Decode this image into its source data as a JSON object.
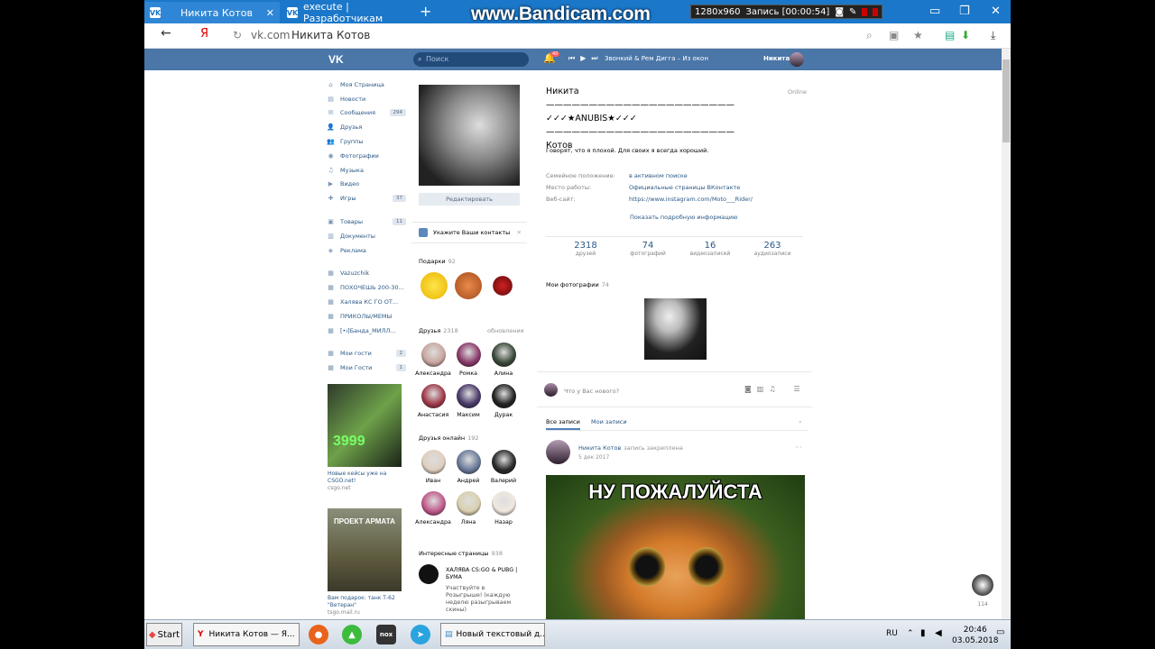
{
  "browser": {
    "tabs": [
      {
        "title": "Никита Котов",
        "icon": "vk-icon"
      },
      {
        "title": "execute | Разработчикам",
        "icon": "vk-icon"
      }
    ],
    "new_tab": "+",
    "address_host": "vk.com",
    "address_title": "Никита Котов",
    "back": "←",
    "yandex": "Я"
  },
  "recorder": {
    "watermark": "www.Bandicam.com",
    "resolution": "1280x960",
    "recording": "Запись [00:00:54]"
  },
  "vk": {
    "search_placeholder": "Поиск",
    "notif_count": "40",
    "track": "Звонкий & Рем Дигга – Из окон",
    "user": "Никита",
    "accent": "#4a76a8"
  },
  "nav": {
    "items": [
      {
        "label": "Моя Страница",
        "icon": "home-icon",
        "glyph": "⌂",
        "count": ""
      },
      {
        "label": "Новости",
        "icon": "news-icon",
        "glyph": "▤",
        "count": ""
      },
      {
        "label": "Сообщения",
        "icon": "message-icon",
        "glyph": "✉",
        "count": "294"
      },
      {
        "label": "Друзья",
        "icon": "friends-icon",
        "glyph": "👤",
        "count": ""
      },
      {
        "label": "Группы",
        "icon": "groups-icon",
        "glyph": "👥",
        "count": ""
      },
      {
        "label": "Фотографии",
        "icon": "camera-icon",
        "glyph": "◉",
        "count": ""
      },
      {
        "label": "Музыка",
        "icon": "music-icon",
        "glyph": "♫",
        "count": ""
      },
      {
        "label": "Видео",
        "icon": "video-icon",
        "glyph": "▶",
        "count": ""
      },
      {
        "label": "Игры",
        "icon": "games-icon",
        "glyph": "✚",
        "count": "37"
      }
    ],
    "items2": [
      {
        "label": "Товары",
        "icon": "shop-icon",
        "glyph": "▣",
        "count": "11"
      },
      {
        "label": "Документы",
        "icon": "docs-icon",
        "glyph": "▥",
        "count": ""
      },
      {
        "label": "Реклама",
        "icon": "ads-icon",
        "glyph": "◈",
        "count": ""
      }
    ],
    "items3": [
      {
        "label": "Vazuzchik",
        "icon": "app-icon",
        "glyph": "▦",
        "count": ""
      },
      {
        "label": "ПОХОЧЕШЬ 200-30...",
        "icon": "app-icon",
        "glyph": "▦",
        "count": ""
      },
      {
        "label": "Халява КС ГО ОТ...",
        "icon": "app-icon",
        "glyph": "▦",
        "count": ""
      },
      {
        "label": "ПРИКОЛЫ/МЕМЫ",
        "icon": "app-icon",
        "glyph": "▦",
        "count": ""
      },
      {
        "label": "[•ı]Банда_МИЛЛ...",
        "icon": "app-icon",
        "glyph": "▦",
        "count": ""
      }
    ],
    "items4": [
      {
        "label": "Мои гости",
        "icon": "guests-icon",
        "glyph": "▦",
        "count": "2"
      },
      {
        "label": "Мои Гости",
        "icon": "guests-icon",
        "glyph": "▦",
        "count": "1"
      }
    ]
  },
  "ads": [
    {
      "title": "Новые кейсы уже на CSGO.net!",
      "source": "csgo.net",
      "badge": "3999"
    },
    {
      "title": "Вам подарок: танк Т-62 \"Ветеран\"",
      "source": "tsgo.mail.ru",
      "badge": "ПРОЕКТ АРМАТА"
    }
  ],
  "profile": {
    "edit": "Редактировать",
    "contacts": "Укажите Ваши контакты",
    "gifts_label": "Подарки",
    "gifts_count": "92",
    "friends_label": "Друзья",
    "friends_count": "2318",
    "friends_updates": "обновления",
    "friends": [
      "Александра",
      "Ромка",
      "Алина",
      "Анастасия",
      "Максим",
      "Дурак"
    ],
    "online_label": "Друзья онлайн",
    "online_count": "192",
    "online_friends": [
      "Иван",
      "Андрей",
      "Валерий",
      "Александра",
      "Ляна",
      "Назар"
    ],
    "pages_label": "Интересные страницы",
    "pages_count": "938",
    "page_title": "ХАЛЯВА CS:GO & PUBG | БУМА",
    "page_desc": "Участвуйте в Розыгрыше! (каждую неделю разыгрываем скины)"
  },
  "info": {
    "name": "Никита\n——————————————————————\n✓✓✓★ANUBIS★✓✓✓\n——————————————————————\nКотов",
    "online": "Online",
    "status": "Говорят, что я плохой. Для своих я всегда хороший.",
    "rows": [
      {
        "label": "Семейное положение:",
        "value": "в активном поиске"
      },
      {
        "label": "Место работы:",
        "value": "Официальные страницы ВКонтакте"
      },
      {
        "label": "Веб-сайт:",
        "value": "https://www.instagram.com/Moto___Rider/"
      }
    ],
    "show_more": "Показать подробную информацию",
    "counters": [
      {
        "value": "2318",
        "label": "друзей"
      },
      {
        "value": "74",
        "label": "фотографий"
      },
      {
        "value": "16",
        "label": "видеозаписей"
      },
      {
        "value": "263",
        "label": "аудиозаписи"
      }
    ],
    "photos_label": "Мои фотографии",
    "photos_count": "74"
  },
  "wall": {
    "placeholder": "Что у Вас нового?",
    "tab_all": "Все записи",
    "tab_mine": "Мои записи",
    "post_author": "Никита Котов",
    "pinned": "запись закреплена",
    "post_date": "5 дек 2017",
    "meme_text": "НУ ПОЖАЛУЙСТА",
    "chat_count": "114"
  },
  "taskbar": {
    "start": "Start",
    "browser_task": "Никита Котов — Я...",
    "notepad_task": "Новый текстовый д...",
    "lang": "RU",
    "time": "20:46",
    "date": "03.05.2018"
  }
}
